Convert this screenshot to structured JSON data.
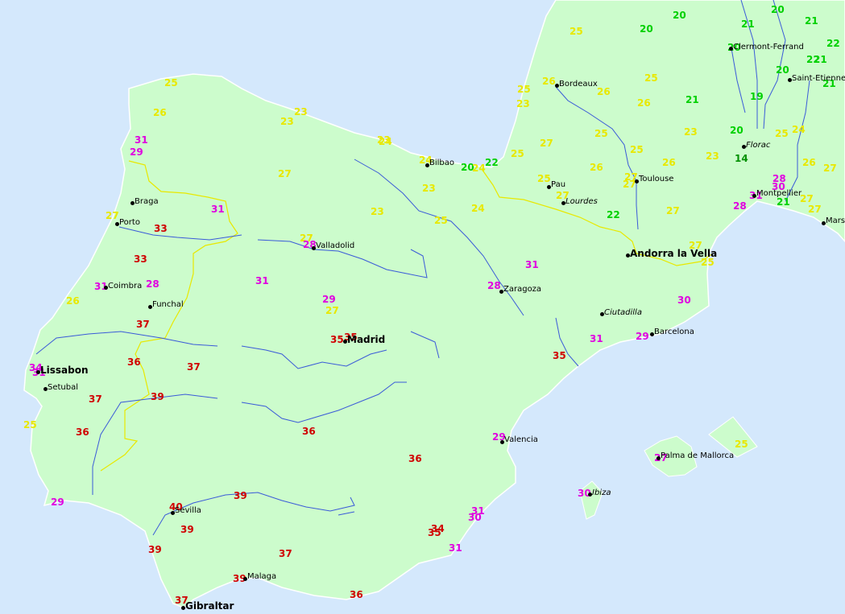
{
  "colors": {
    "sea": "#d4e8fc",
    "land": "#ccfccc",
    "coast": "#ffffff",
    "river": "#3a5ad8",
    "border": "#e8e800",
    "temp_green": "#00d000",
    "temp_yellow": "#e8e800",
    "temp_magenta": "#e000e0",
    "temp_red": "#d00000",
    "temp_darkgreen": "#009000"
  },
  "cities": [
    {
      "name": "Clermont-Ferrand",
      "style": "normal"
    },
    {
      "name": "Saint-Etienne",
      "style": "normal"
    },
    {
      "name": "Bordeaux",
      "style": "normal"
    },
    {
      "name": "Florac",
      "style": "italic"
    },
    {
      "name": "Bilbao",
      "style": "normal"
    },
    {
      "name": "Pau",
      "style": "normal"
    },
    {
      "name": "Toulouse",
      "style": "normal"
    },
    {
      "name": "Lourdes",
      "style": "italic"
    },
    {
      "name": "Montpellier",
      "style": "normal"
    },
    {
      "name": "Mars",
      "style": "normal"
    },
    {
      "name": "Braga",
      "style": "normal"
    },
    {
      "name": "Porto",
      "style": "normal"
    },
    {
      "name": "Valladolid",
      "style": "normal"
    },
    {
      "name": "Andorra la Vella",
      "style": "capital"
    },
    {
      "name": "Coimbra",
      "style": "normal"
    },
    {
      "name": "Zaragoza",
      "style": "normal"
    },
    {
      "name": "Funchal",
      "style": "normal"
    },
    {
      "name": "Ciutadilla",
      "style": "italic"
    },
    {
      "name": "Barcelona",
      "style": "normal"
    },
    {
      "name": "Madrid",
      "style": "capital"
    },
    {
      "name": "Lissabon",
      "style": "capital"
    },
    {
      "name": "Setubal",
      "style": "normal"
    },
    {
      "name": "Valencia",
      "style": "normal"
    },
    {
      "name": "Palma de Mallorca",
      "style": "normal"
    },
    {
      "name": "Ibiza",
      "style": "italic"
    },
    {
      "name": "Sevilla",
      "style": "normal"
    },
    {
      "name": "Malaga",
      "style": "normal"
    },
    {
      "name": "Gibraltar",
      "style": "capital"
    }
  ],
  "temperatures": [
    {
      "value": "20",
      "color": "green"
    },
    {
      "value": "20",
      "color": "green"
    },
    {
      "value": "20",
      "color": "green"
    },
    {
      "value": "21",
      "color": "green"
    },
    {
      "value": "21",
      "color": "green"
    },
    {
      "value": "22",
      "color": "green"
    },
    {
      "value": "20",
      "color": "green"
    },
    {
      "value": "22",
      "color": "green"
    },
    {
      "value": "21",
      "color": "green"
    },
    {
      "value": "20",
      "color": "green"
    },
    {
      "value": "21",
      "color": "green"
    },
    {
      "value": "21",
      "color": "green"
    },
    {
      "value": "19",
      "color": "green"
    },
    {
      "value": "20",
      "color": "green"
    },
    {
      "value": "14",
      "color": "darkgreen"
    },
    {
      "value": "20",
      "color": "green"
    },
    {
      "value": "22",
      "color": "green"
    },
    {
      "value": "22",
      "color": "green"
    },
    {
      "value": "21",
      "color": "green"
    },
    {
      "value": "25",
      "color": "yellow"
    },
    {
      "value": "25",
      "color": "yellow"
    },
    {
      "value": "25",
      "color": "yellow"
    },
    {
      "value": "26",
      "color": "yellow"
    },
    {
      "value": "26",
      "color": "yellow"
    },
    {
      "value": "23",
      "color": "yellow"
    },
    {
      "value": "23",
      "color": "yellow"
    },
    {
      "value": "23",
      "color": "yellow"
    },
    {
      "value": "23",
      "color": "yellow"
    },
    {
      "value": "25",
      "color": "yellow"
    },
    {
      "value": "26",
      "color": "yellow"
    },
    {
      "value": "26",
      "color": "yellow"
    },
    {
      "value": "23",
      "color": "yellow"
    },
    {
      "value": "25",
      "color": "yellow"
    },
    {
      "value": "24",
      "color": "yellow"
    },
    {
      "value": "24",
      "color": "yellow"
    },
    {
      "value": "27",
      "color": "yellow"
    },
    {
      "value": "25",
      "color": "yellow"
    },
    {
      "value": "23",
      "color": "yellow"
    },
    {
      "value": "25",
      "color": "yellow"
    },
    {
      "value": "26",
      "color": "yellow"
    },
    {
      "value": "26",
      "color": "yellow"
    },
    {
      "value": "27",
      "color": "yellow"
    },
    {
      "value": "24",
      "color": "yellow"
    },
    {
      "value": "23",
      "color": "yellow"
    },
    {
      "value": "25",
      "color": "yellow"
    },
    {
      "value": "27",
      "color": "yellow"
    },
    {
      "value": "23",
      "color": "yellow"
    },
    {
      "value": "25",
      "color": "yellow"
    },
    {
      "value": "24",
      "color": "yellow"
    },
    {
      "value": "27",
      "color": "yellow"
    },
    {
      "value": "27",
      "color": "yellow"
    },
    {
      "value": "24",
      "color": "yellow"
    },
    {
      "value": "25",
      "color": "yellow"
    },
    {
      "value": "27",
      "color": "yellow"
    },
    {
      "value": "26",
      "color": "yellow"
    },
    {
      "value": "27",
      "color": "yellow"
    },
    {
      "value": "27",
      "color": "yellow"
    },
    {
      "value": "27",
      "color": "yellow"
    },
    {
      "value": "27",
      "color": "yellow"
    },
    {
      "value": "25",
      "color": "yellow"
    },
    {
      "value": "27",
      "color": "yellow"
    },
    {
      "value": "26",
      "color": "yellow"
    },
    {
      "value": "27",
      "color": "yellow"
    },
    {
      "value": "25",
      "color": "yellow"
    },
    {
      "value": "25",
      "color": "yellow"
    },
    {
      "value": "27",
      "color": "yellow"
    },
    {
      "value": "31",
      "color": "magenta"
    },
    {
      "value": "29",
      "color": "magenta"
    },
    {
      "value": "31",
      "color": "magenta"
    },
    {
      "value": "28",
      "color": "magenta"
    },
    {
      "value": "28",
      "color": "magenta"
    },
    {
      "value": "31",
      "color": "magenta"
    },
    {
      "value": "29",
      "color": "magenta"
    },
    {
      "value": "28",
      "color": "magenta"
    },
    {
      "value": "31",
      "color": "magenta"
    },
    {
      "value": "28",
      "color": "magenta"
    },
    {
      "value": "31",
      "color": "magenta"
    },
    {
      "value": "28",
      "color": "magenta"
    },
    {
      "value": "31",
      "color": "magenta"
    },
    {
      "value": "29",
      "color": "magenta"
    },
    {
      "value": "30",
      "color": "magenta"
    },
    {
      "value": "31",
      "color": "magenta"
    },
    {
      "value": "29",
      "color": "magenta"
    },
    {
      "value": "34",
      "color": "magenta"
    },
    {
      "value": "31",
      "color": "magenta"
    },
    {
      "value": "29",
      "color": "magenta"
    },
    {
      "value": "27",
      "color": "magenta"
    },
    {
      "value": "30",
      "color": "magenta"
    },
    {
      "value": "31",
      "color": "magenta"
    },
    {
      "value": "30",
      "color": "magenta"
    },
    {
      "value": "31",
      "color": "magenta"
    },
    {
      "value": "30",
      "color": "magenta"
    },
    {
      "value": "33",
      "color": "red"
    },
    {
      "value": "33",
      "color": "red"
    },
    {
      "value": "37",
      "color": "red"
    },
    {
      "value": "35",
      "color": "red"
    },
    {
      "value": "35",
      "color": "red"
    },
    {
      "value": "35",
      "color": "red"
    },
    {
      "value": "36",
      "color": "red"
    },
    {
      "value": "37",
      "color": "red"
    },
    {
      "value": "39",
      "color": "red"
    },
    {
      "value": "37",
      "color": "red"
    },
    {
      "value": "36",
      "color": "red"
    },
    {
      "value": "36",
      "color": "red"
    },
    {
      "value": "36",
      "color": "red"
    },
    {
      "value": "40",
      "color": "red"
    },
    {
      "value": "39",
      "color": "red"
    },
    {
      "value": "39",
      "color": "red"
    },
    {
      "value": "34",
      "color": "red"
    },
    {
      "value": "35",
      "color": "red"
    },
    {
      "value": "39",
      "color": "red"
    },
    {
      "value": "37",
      "color": "red"
    },
    {
      "value": "39",
      "color": "red"
    },
    {
      "value": "37",
      "color": "red"
    },
    {
      "value": "36",
      "color": "red"
    }
  ]
}
